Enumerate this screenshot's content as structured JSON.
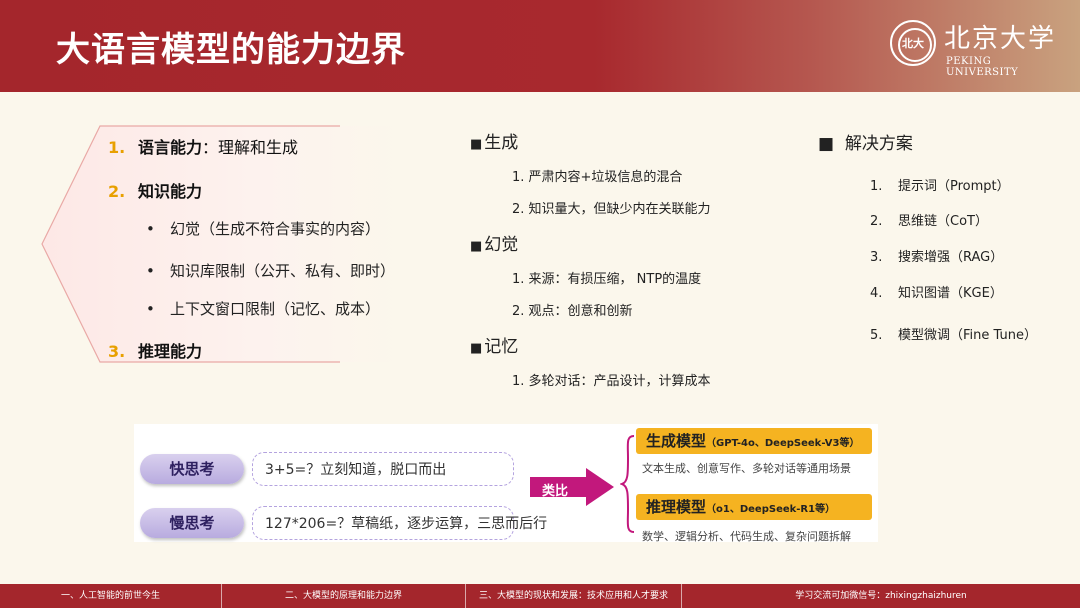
{
  "header": {
    "title": "大语言模型的能力边界"
  },
  "logo": {
    "cn": "北京大学",
    "en": "PEKING UNIVERSITY"
  },
  "left": {
    "items": [
      {
        "num": "1.",
        "bold": "语言能力",
        "rest": "：理解和生成"
      },
      {
        "num": "2.",
        "bold": "知识能力",
        "rest": ""
      },
      {
        "num": "3.",
        "bold": "推理能力",
        "rest": ""
      }
    ],
    "subitems": [
      {
        "bullet": "•",
        "text": "幻觉（生成不符合事实的内容）"
      },
      {
        "bullet": "•",
        "text": "知识库限制（公开、私有、即时）"
      },
      {
        "bullet": "•",
        "text": "上下文窗口限制（记忆、成本）"
      }
    ]
  },
  "middle": {
    "sections": [
      {
        "mark": "■",
        "title": "生成",
        "items": [
          "1.  严肃内容+垃圾信息的混合",
          "2.  知识量大，但缺少内在关联能力"
        ]
      },
      {
        "mark": "■",
        "title": "幻觉",
        "items": [
          "1.  来源：有损压缩，  NTP的温度",
          "2.  观点：创意和创新"
        ]
      },
      {
        "mark": "■",
        "title": "记忆",
        "items": [
          "1.  多轮对话：产品设计，计算成本"
        ]
      }
    ]
  },
  "right": {
    "mark": "■",
    "title": "解决方案",
    "items": [
      {
        "n": "1.",
        "text": "提示词（Prompt）"
      },
      {
        "n": "2.",
        "text": "思维链（CoT）"
      },
      {
        "n": "3.",
        "text": "搜索增强（RAG）"
      },
      {
        "n": "4.",
        "text": "知识图谱（KGE）"
      },
      {
        "n": "5.",
        "text": "模型微调（Fine Tune）"
      }
    ]
  },
  "compare": {
    "fast": {
      "label": "快思考",
      "desc": "3+5=？立刻知道，脱口而出"
    },
    "slow": {
      "label": "慢思考",
      "desc": "127*206=？草稿纸，逐步运算，三思而后行"
    },
    "arrow_label": "类比",
    "gen": {
      "title": "生成模型",
      "paren": "（GPT-4o、DeepSeek-V3等）",
      "desc": "文本生成、创意写作、多轮对话等通用场景"
    },
    "reason": {
      "title": "推理模型",
      "paren": "（o1、DeepSeek-R1等）",
      "desc": "数学、逻辑分析、代码生成、复杂问题拆解"
    }
  },
  "footer": {
    "tabs": [
      "一、人工智能的前世今生",
      "二、大模型的原理和能力边界",
      "三、大模型的现状和发展：技术应用和人才要求",
      "学习交流可加微信号：zhixingzhaizhuren"
    ]
  },
  "colors": {
    "brand": "#a4262c",
    "accent": "#e8a000",
    "bar": "#f5b321",
    "arrow": "#c2187c",
    "background": "#fbf7ec"
  }
}
